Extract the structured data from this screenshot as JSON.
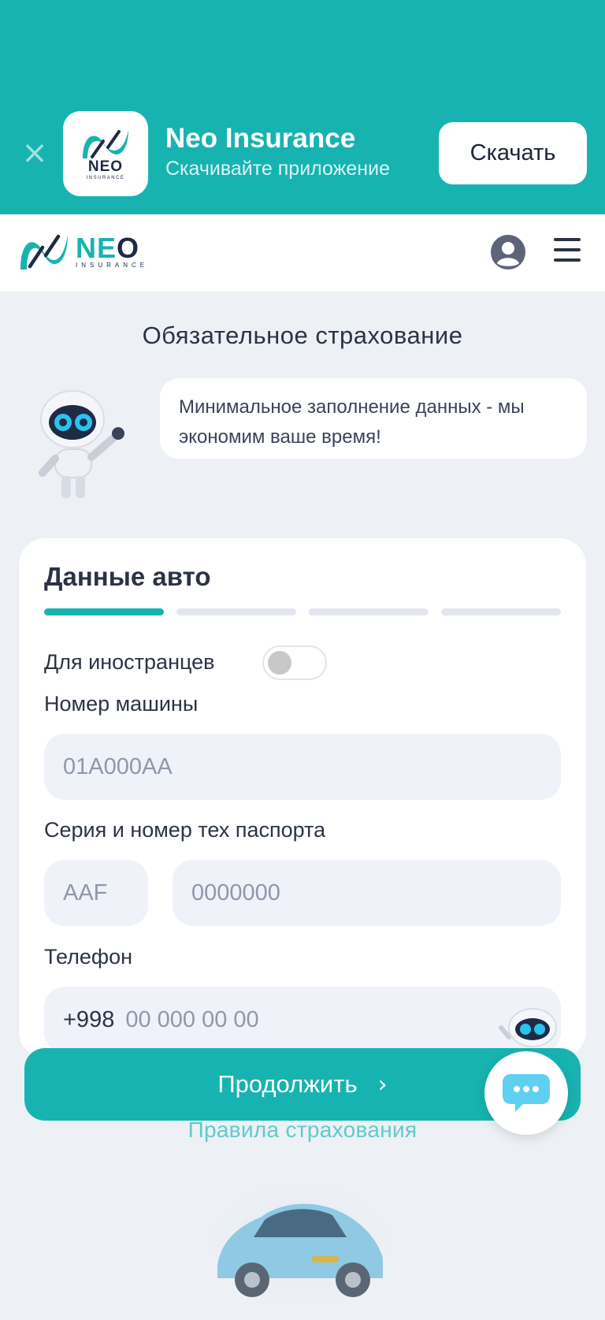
{
  "banner": {
    "app_name": "Neo Insurance",
    "subtitle": "Скачивайте приложение",
    "download_label": "Скачать",
    "close_symbol": "×",
    "logo_word": "NEO",
    "logo_sub": "INSURANCE"
  },
  "header": {
    "logo_word_teal": "NE",
    "logo_word_dark": "O",
    "logo_sub": "INSURANCE",
    "profile_icon": "user-circle-icon",
    "menu_icon": "hamburger-menu-icon"
  },
  "intro": {
    "title": "Обязательное страхование",
    "bubble_text": "Минимальное заполнение данных - мы экономим ваше время!"
  },
  "form": {
    "title": "Данные авто",
    "steps_total": 4,
    "active_step": 1,
    "foreigners_label": "Для иностранцев",
    "foreigners_toggle_on": false,
    "car_number_label": "Номер машины",
    "car_number_placeholder": "01A000AA",
    "passport_label": "Серия и номер тех паспорта",
    "passport_series_placeholder": "AAF",
    "passport_number_placeholder": "0000000",
    "phone_label": "Телефон",
    "phone_prefix": "+998",
    "phone_placeholder": "00 000 00 00"
  },
  "actions": {
    "continue_label": "Продолжить",
    "continue_icon": "chevron-right-icon",
    "chevron": "›",
    "rules_link": "Правила страхования"
  },
  "colors": {
    "brand_teal": "#17b3b1",
    "background": "#edf0f5",
    "text_dark": "#2b3345"
  }
}
